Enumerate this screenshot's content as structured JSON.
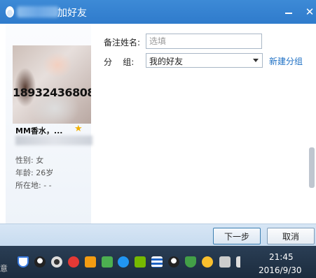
{
  "window": {
    "title": "加好友",
    "minimize_label": "",
    "close_label": "✕"
  },
  "profile": {
    "avatar_overlay_text": "18932436808",
    "nickname": "MM香水，...",
    "gender": "性别: 女",
    "age": "年龄: 26岁",
    "location": "所在地: -   -"
  },
  "form": {
    "remark_label": "备注姓名:",
    "remark_placeholder": "选填",
    "remark_value": "",
    "group_label": "分    组:",
    "group_value": "我的好友",
    "new_group_link": "新建分组"
  },
  "buttons": {
    "next": "下一步",
    "cancel": "取消"
  },
  "taskbar": {
    "left_glyph": "意",
    "time": "21:45",
    "date": "2016/9/30"
  },
  "colors": {
    "titlebar": "#3d8ad6",
    "link": "#1c6fc4",
    "star": "#f2b000"
  }
}
